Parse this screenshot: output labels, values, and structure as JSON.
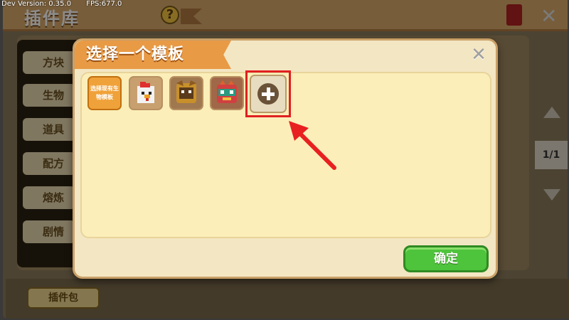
{
  "debug": {
    "dev_version": "Dev Version: 0.35.0",
    "fps": "FPS:677.0"
  },
  "background": {
    "title": "插件库",
    "help_icon_text": "?",
    "tabs": [
      "方块",
      "生物",
      "道具",
      "配方",
      "熔炼",
      "剧情"
    ],
    "page_indicator": "1/1",
    "plugin_pack_button": "插件包"
  },
  "modal": {
    "title": "选择一个模板",
    "select_existing_label": "选择现有生物模板",
    "templates": [
      {
        "icon": "chicken-icon"
      },
      {
        "icon": "wolf-armor-icon"
      },
      {
        "icon": "masked-creature-icon"
      }
    ],
    "add_icon": "plus-icon",
    "confirm_label": "确定",
    "colors": {
      "accent": "#e89a45",
      "panel": "#fbeeb9",
      "confirm": "#4ec33c",
      "highlight": "#e02020"
    }
  }
}
